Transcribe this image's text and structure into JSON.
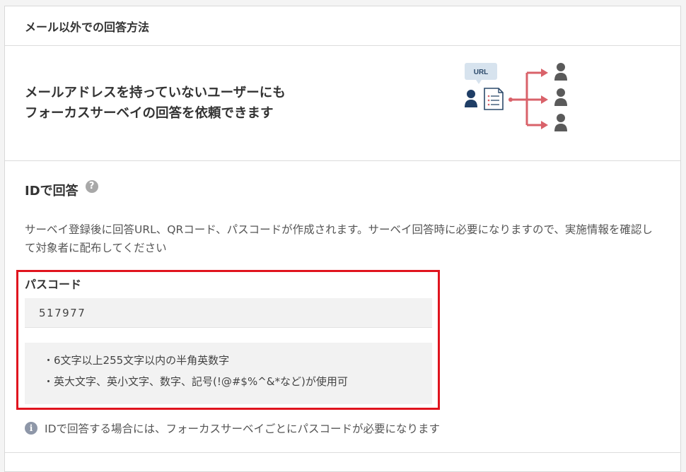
{
  "section": {
    "title": "メール以外での回答方法"
  },
  "banner": {
    "line1": "メールアドレスを持っていないユーザーにも",
    "line2": "フォーカスサーベイの回答を依頼できます",
    "illustration": {
      "bubble_text": "URL",
      "accent_color": "#d9626a"
    }
  },
  "id_answer": {
    "title": "IDで回答",
    "help_icon": "?",
    "description": "サーベイ登録後に回答URL、QRコード、パスコードが作成されます。サーベイ回答時に必要になりますので、実施情報を確認して対象者に配布してください",
    "passcode_label": "パスコード",
    "passcode_value": "517977",
    "rules": [
      "・6文字以上255文字以内の半角英数字",
      "・英大文字、英小文字、数字、記号(!@#$%^&*など)が使用可"
    ],
    "info_icon": "i",
    "info_text": "IDで回答する場合には、フォーカスサーベイごとにパスコードが必要になります"
  }
}
